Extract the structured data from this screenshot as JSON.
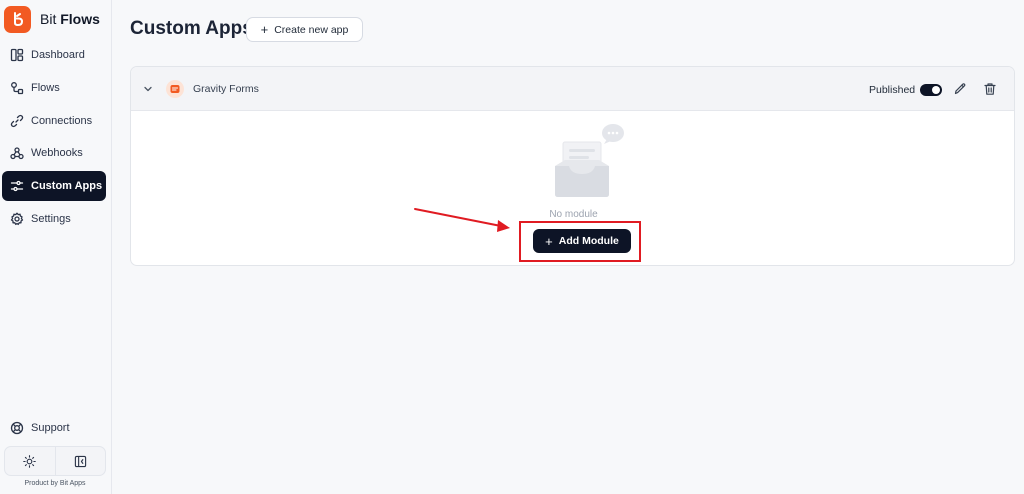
{
  "brand": {
    "name_part1": "Bit",
    "name_part2": "Flows",
    "logo_icon": "bit-flows-logo-icon",
    "accent_color": "#f25a22"
  },
  "sidebar": {
    "items": [
      {
        "label": "Dashboard",
        "icon": "dashboard-icon"
      },
      {
        "label": "Flows",
        "icon": "flows-icon"
      },
      {
        "label": "Connections",
        "icon": "link-icon"
      },
      {
        "label": "Webhooks",
        "icon": "webhook-icon"
      },
      {
        "label": "Custom Apps",
        "icon": "sliders-icon",
        "active": true
      },
      {
        "label": "Settings",
        "icon": "gear-icon"
      }
    ],
    "support_label": "Support",
    "product_by": "Product by Bit Apps"
  },
  "header": {
    "title": "Custom Apps",
    "create_label": "Create new app"
  },
  "app_card": {
    "name": "Gravity Forms",
    "published_label": "Published",
    "published": true,
    "empty_text": "No module",
    "add_module_label": "Add Module"
  },
  "colors": {
    "primary_dark": "#0d1426",
    "annotation_red": "#e01b22"
  }
}
